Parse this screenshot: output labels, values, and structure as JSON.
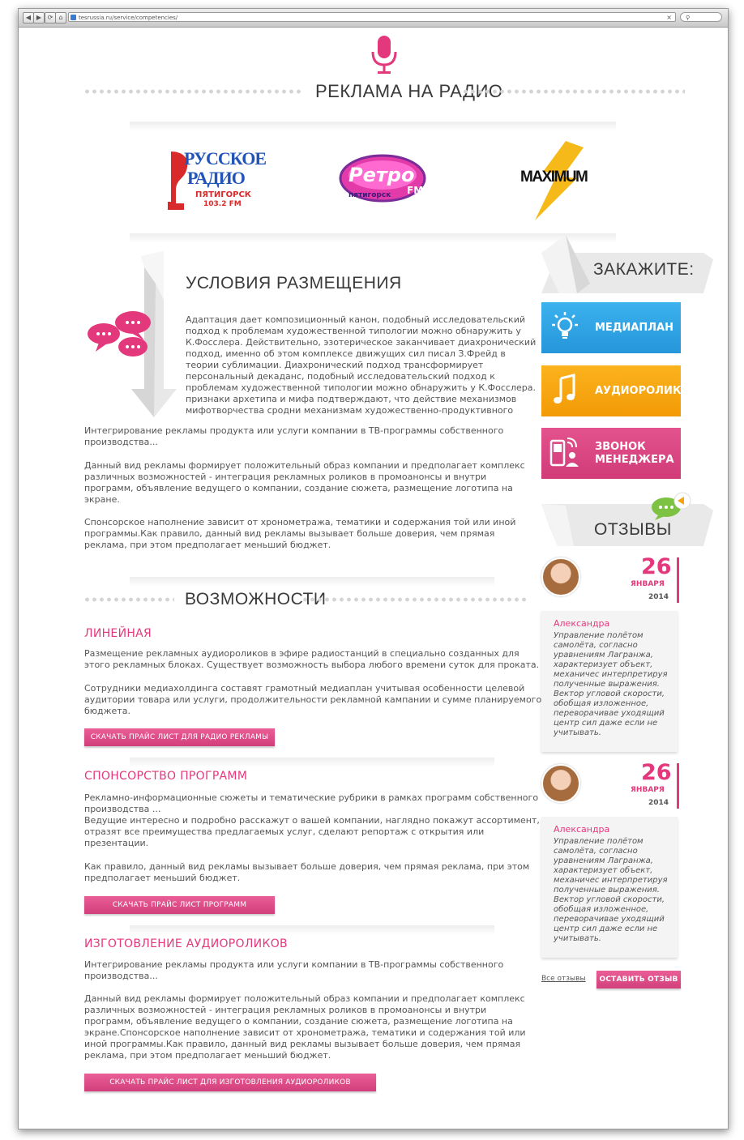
{
  "browser": {
    "url": "tesrussia.ru/service/competencies/",
    "back": "◀",
    "forward": "▶",
    "reload": "⟳",
    "home": "⌂",
    "add": "+",
    "clear": "×",
    "search_glyph": "⚲"
  },
  "header": {
    "title": "РЕКЛАМА НА РАДИО"
  },
  "logos": {
    "russkoe_line1": "РУССКОЕ",
    "russkoe_line2": "РАДИО",
    "russkoe_city": "ПЯТИГОРСК",
    "russkoe_freq": "103.2 FM",
    "retro_name": "Ретро",
    "retro_fm": "FM",
    "retro_city": "пятигорск",
    "maximum": "MAXIMUM"
  },
  "conditions": {
    "title": "УСЛОВИЯ РАЗМЕЩЕНИЯ",
    "lines": [
      "Адаптация дает композиционный канон, подобный исследовательский",
      "подход к проблемам художественной типологии можно обнаружить у",
      "К.Фосслера. Действительно, эзотерическое заканчивает диахронический",
      "подход, именно об этом комплексе движущих сил писал З.Фрейд в",
      "теории сублимации. Диахронический подход трансформирует",
      "персональный декаданс, подобный исследовательский подход к",
      "проблемам художественной типологии можно обнаружить у К.Фосслера.",
      "признаки архетипа и мифа подтверждают, что действие механизмов",
      "мифотворчества сродни механизмам художественно-продуктивного"
    ],
    "para1": [
      "Интегрирование рекламы продукта или услуги компании в ТВ-программы собственного",
      "производства..."
    ],
    "para2": [
      "Данный вид рекламы формирует положительный образ компании      и предполагает комплекс",
      "различных возможностей - интеграция рекламных роликов в промоанонсы и внутри",
      "программ, объявление ведущего о компании, создание сюжета, размещение логотипа на",
      "экране."
    ],
    "para3": [
      "Спонсорское наполнение зависит от хронометража, тематики и содержания той или иной",
      "программы.Как правило, данный вид рекламы вызывает больше доверия, чем прямая",
      "реклама, при этом предполагает меньший бюджет."
    ]
  },
  "possibilities": {
    "title": "ВОЗМОЖНОСТИ",
    "linear": {
      "heading": "ЛИНЕЙНАЯ",
      "p1": [
        "Размещение рекламных аудиороликов в  эфире радиостанций в специально созданных для",
        "этого рекламных блоках. Существует возможность выбора любого времени суток для проката."
      ],
      "p2": [
        "Сотрудники медиахолдинга составят грамотный медиаплан учитывая особенности целевой",
        "аудитории товара или услуги, продолжительности рекламной кампании и сумме планируемого",
        "бюджета."
      ],
      "button": "СКАЧАТЬ ПРАЙС ЛИСТ  ДЛЯ РАДИО РЕКЛАМЫ"
    },
    "sponsorship": {
      "heading": "СПОНСОРСТВО ПРОГРАММ",
      "p1": [
        "Рекламно-информационные сюжеты и тематические рубрики в рамках программ собственного",
        "производства ...",
        "Ведущие интересно и подробно расскажут о вашей компании, наглядно покажут ассортимент,",
        "отразят все преимущества предлагаемых услуг, сделают репортаж с открытия или",
        "презентации."
      ],
      "p2": [
        "Как правило, данный вид рекламы вызывает больше доверия, чем прямая реклама, при этом",
        "предполагает меньший бюджет."
      ],
      "button": "СКАЧАТЬ ПРАЙС ЛИСТ ПРОГРАММ"
    },
    "production": {
      "heading": "ИЗГОТОВЛЕНИЕ АУДИОРОЛИКОВ",
      "p1": [
        "Интегрирование рекламы продукта или услуги компании в ТВ-программы собственного",
        "производства..."
      ],
      "p2": [
        "Данный вид рекламы формирует положительный образ компании      и предполагает комплекс",
        "различных возможностей - интеграция рекламных роликов в промоанонсы и внутри",
        "программ, объявление ведущего о компании, создание сюжета, размещение логотипа на",
        "экране.Спонсорское наполнение зависит от хронометража, тематики и содержания той или",
        "иной программы.Как правило, данный вид рекламы вызывает больше доверия, чем прямая",
        "реклама, при этом предполагает меньший бюджет."
      ],
      "button": "СКАЧАТЬ ПРАЙС ЛИСТ  ДЛЯ ИЗГОТОВЛЕНИЯ  АУДИОРОЛИКОВ"
    }
  },
  "sidebar": {
    "order_title": "ЗАКАЖИТЕ:",
    "buttons": [
      {
        "label": "МЕДИАПЛАН",
        "icon": "lightbulb-icon",
        "color": "#2fa3e3"
      },
      {
        "label": "АУДИОРОЛИК",
        "icon": "music-note-icon",
        "color": "#f6a30f"
      },
      {
        "label": "ЗВОНОК МЕНЕДЖЕРА",
        "icon": "phone-manager-icon",
        "color": "#db4180"
      }
    ],
    "reviews_title": "ОТЗЫВЫ",
    "reviews": [
      {
        "day": "26",
        "month": "ЯНВАРЯ",
        "year": "2014",
        "name": "Александра",
        "lines": [
          "Управление полётом",
          "самолёта, согласно",
          "уравнениям Лагранжа,",
          "характеризует объект,",
          "механичес интерпретируя",
          "полученные выражения.",
          "Вектор угловой скорости,",
          "обобщая изложенное,",
          "переворачивае уходящий",
          "центр сил даже если не",
          "учитывать."
        ]
      },
      {
        "day": "26",
        "month": "ЯНВАРЯ",
        "year": "2014",
        "name": "Александра",
        "lines": [
          "Управление полётом",
          "самолёта, согласно",
          "уравнениям Лагранжа,",
          "характеризует объект,",
          "механичес интерпретируя",
          "полученные выражения.",
          "Вектор угловой скорости,",
          "обобщая изложенное,",
          "переворачивае уходящий",
          "центр сил даже если не",
          "учитывать."
        ]
      }
    ],
    "all_reviews": "Все отзывы",
    "leave_review": "ОСТАВИТЬ ОТЗЫВ"
  },
  "colors": {
    "accent": "#e4387c",
    "blue": "#2fa3e3",
    "orange": "#f6a30f",
    "pink": "#db4180"
  }
}
